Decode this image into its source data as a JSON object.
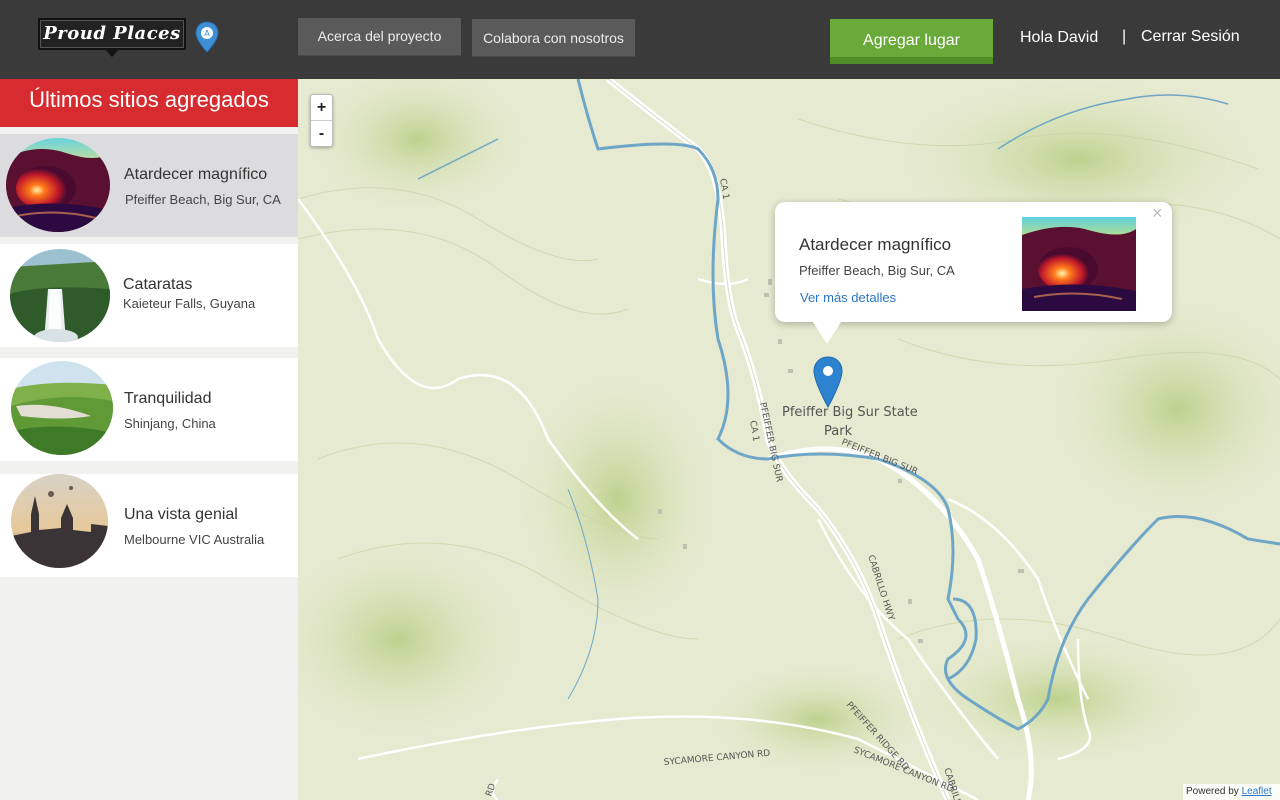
{
  "header": {
    "logo_text": "Proud Places",
    "about_label": "Acerca del proyecto",
    "collab_label": "Colabora con nosotros",
    "add_place_label": "Agregar lugar",
    "greeting": "Hola David",
    "separator": "|",
    "logout_label": "Cerrar Sesión"
  },
  "sidebar": {
    "title": "Últimos sitios agregados",
    "places": [
      {
        "title": "Atardecer magnífico",
        "location": "Pfeiffer Beach, Big Sur, CA",
        "active": true
      },
      {
        "title": "Cataratas",
        "location": "Kaieteur Falls, Guyana",
        "active": false
      },
      {
        "title": "Tranquilidad",
        "location": "Shinjang, China",
        "active": false
      },
      {
        "title": "Una vista genial",
        "location": "Melbourne VIC Australia",
        "active": false
      }
    ]
  },
  "map": {
    "zoom_in": "+",
    "zoom_out": "-",
    "labels": {
      "park": "Pfeiffer Big Sur State",
      "park2": "Park",
      "road_pfeiffer": "PFEIFFER BIG SUR",
      "road_pfeiffer2": "PFEIFFER BIG SUR",
      "road_ca1": "CA 1",
      "road_ca1b": "CA 1",
      "road_cabrillo": "CABRILLO HWY",
      "road_cabrillo2": "CABRILLO",
      "road_ridge": "PFEIFFER RIDGE RD",
      "road_sycamore": "SYCAMORE CANYON RD",
      "road_sycamore2": "SYCAMORE CANYON RD",
      "road_rd": "RD"
    },
    "popup": {
      "title": "Atardecer magnífico",
      "location": "Pfeiffer Beach, Big Sur, CA",
      "link": "Ver más detalles",
      "close": "×"
    },
    "attribution_prefix": "Powered by",
    "attribution_link": "Leaflet"
  },
  "colors": {
    "topbar": "#3a3a3a",
    "accent_red": "#d62b2f",
    "accent_green": "#6aaa3a",
    "river": "#6ea6c8",
    "marker": "#2d83cf"
  }
}
